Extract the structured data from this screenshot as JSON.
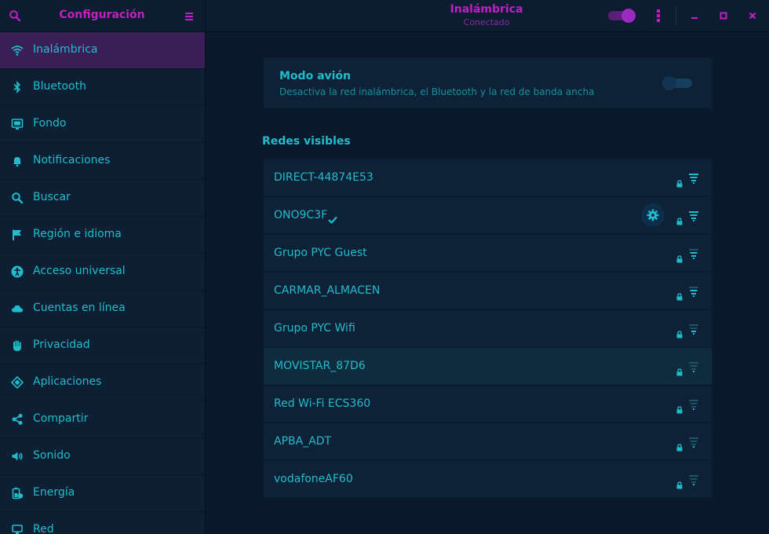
{
  "header": {
    "app_title": "Configuración",
    "panel_title": "Inalámbrica",
    "panel_subtitle": "Conectado",
    "wifi_enabled": true
  },
  "sidebar": {
    "items": [
      {
        "label": "Inalámbrica",
        "icon": "wifi-icon",
        "active": true
      },
      {
        "label": "Bluetooth",
        "icon": "bluetooth-icon"
      },
      {
        "label": "Fondo",
        "icon": "background-icon"
      },
      {
        "label": "Notificaciones",
        "icon": "bell-icon"
      },
      {
        "label": "Buscar",
        "icon": "search-icon"
      },
      {
        "label": "Región e idioma",
        "icon": "flag-icon"
      },
      {
        "label": "Acceso universal",
        "icon": "accessibility-icon"
      },
      {
        "label": "Cuentas en línea",
        "icon": "cloud-icon"
      },
      {
        "label": "Privacidad",
        "icon": "hand-icon"
      },
      {
        "label": "Aplicaciones",
        "icon": "apps-icon"
      },
      {
        "label": "Compartir",
        "icon": "share-icon"
      },
      {
        "label": "Sonido",
        "icon": "speaker-icon"
      },
      {
        "label": "Energía",
        "icon": "battery-icon"
      },
      {
        "label": "Red",
        "icon": "network-icon"
      }
    ]
  },
  "airplane_mode": {
    "title": "Modo avión",
    "description": "Desactiva la red inalámbrica, el Bluetooth y la red de banda ancha",
    "enabled": false
  },
  "networks": {
    "section_title": "Redes visibles",
    "items": [
      {
        "name": "DIRECT-44874E53",
        "connected": false,
        "signal": "excellent"
      },
      {
        "name": "ONO9C3F",
        "connected": true,
        "signal": "excellent"
      },
      {
        "name": "Grupo PYC Guest",
        "connected": false,
        "signal": "good"
      },
      {
        "name": "CARMAR_ALMACEN",
        "connected": false,
        "signal": "good"
      },
      {
        "name": "Grupo PYC Wifi",
        "connected": false,
        "signal": "ok"
      },
      {
        "name": "MOVISTAR_87D6",
        "connected": false,
        "signal": "weak"
      },
      {
        "name": "Red Wi-Fi ECS360",
        "connected": false,
        "signal": "weak"
      },
      {
        "name": "APBA_ADT",
        "connected": false,
        "signal": "weak"
      },
      {
        "name": "vodafoneAF60",
        "connected": false,
        "signal": "weak"
      }
    ]
  },
  "colors": {
    "accent_text": "#22bccb",
    "title_magenta": "#c21fc2",
    "active_item_bg": "#3a1f56"
  }
}
